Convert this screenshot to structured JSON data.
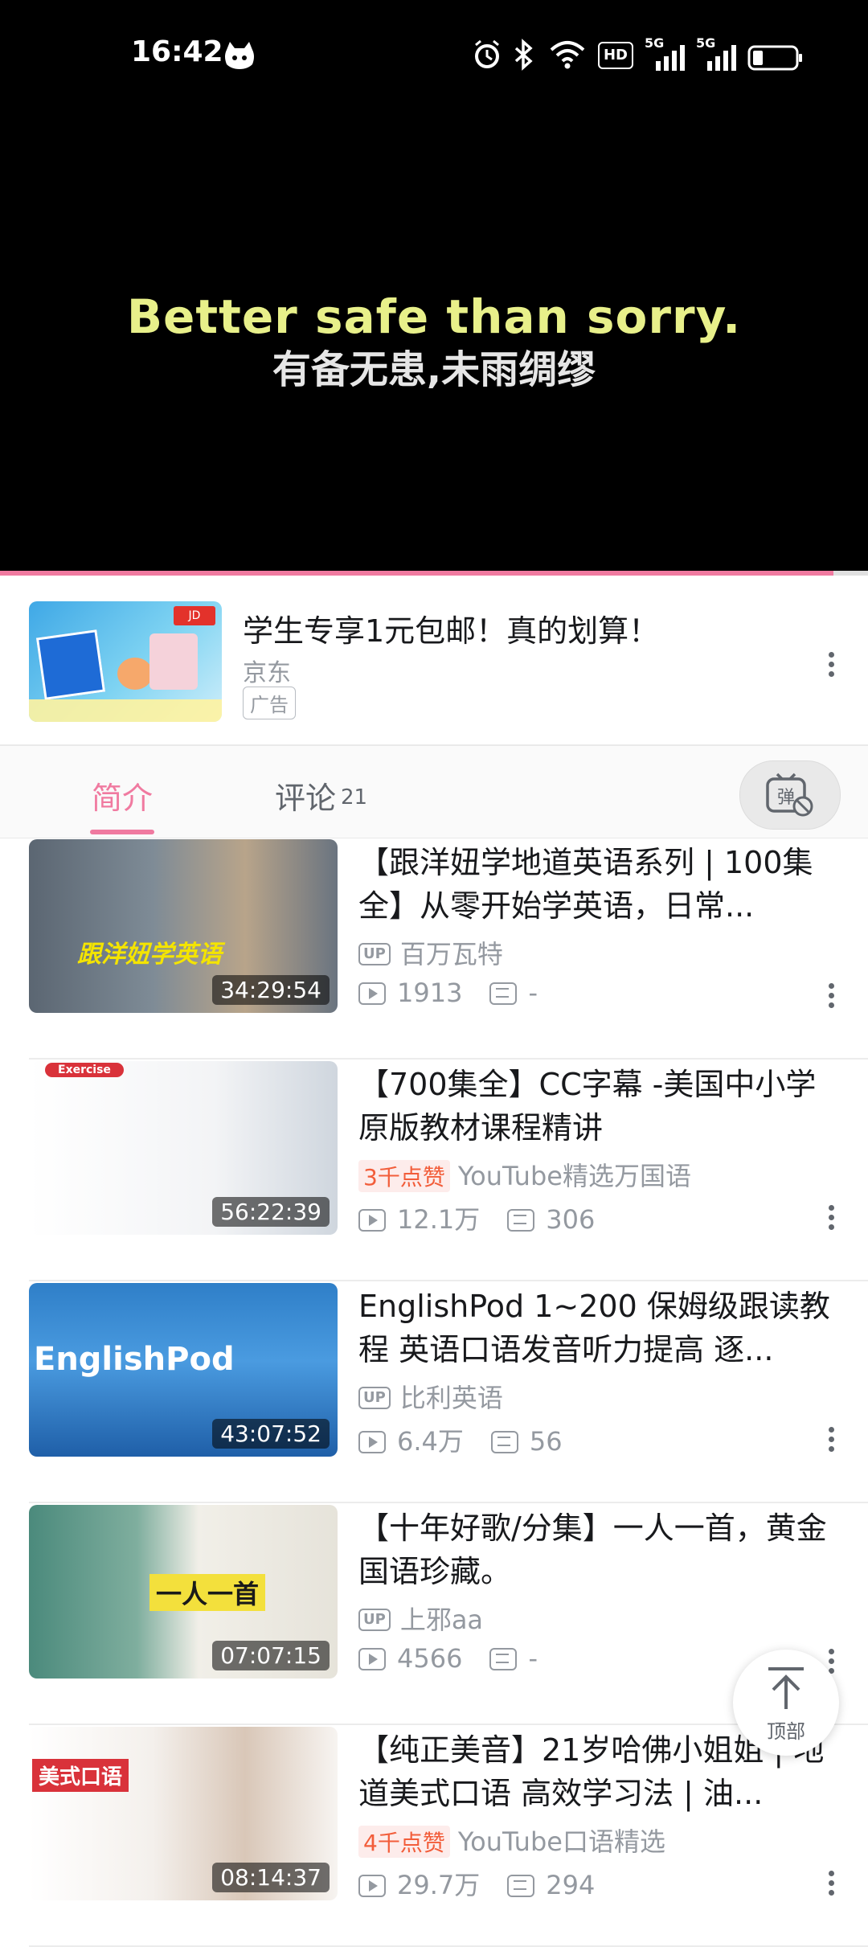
{
  "status_bar": {
    "time": "16:42",
    "icons": [
      "cat-app-icon",
      "alarm-icon",
      "bluetooth-icon",
      "wifi-icon",
      "hd-icon",
      "5g-signal-icon",
      "5g-signal-icon",
      "battery-icon"
    ],
    "hd_label": "HD",
    "net_label_1": "5G",
    "net_label_2": "5G"
  },
  "video": {
    "subtitle_en": "Better safe than sorry.",
    "subtitle_cn": "有备无患,未雨绸缪",
    "progress": 0.96
  },
  "ad": {
    "title": "学生专享1元包邮！真的划算！",
    "source": "京东",
    "badge": "广告"
  },
  "tabs": {
    "intro": "简介",
    "comments": "评论",
    "comments_count": "21",
    "danmaku_icon": "弹"
  },
  "videos": [
    {
      "title": "【跟洋妞学地道英语系列 | 100集全】从零开始学英语，日常...",
      "duration": "34:29:54",
      "author": "百万瓦特",
      "author_badge": "UP",
      "likes_badge": "",
      "views": "1913",
      "comments": "-",
      "thumb_text": "跟洋妞学英语"
    },
    {
      "title": "【700集全】CC字幕 -美国中小学原版教材课程精讲",
      "duration": "56:22:39",
      "author": "YouTube精选万国语",
      "author_badge": "",
      "likes_badge": "3千点赞",
      "views": "12.1万",
      "comments": "306",
      "thumb_text": "Exercise"
    },
    {
      "title": "EnglishPod 1~200 保姆级跟读教程 英语口语发音听力提高 逐...",
      "duration": "43:07:52",
      "author": "比利英语",
      "author_badge": "UP",
      "likes_badge": "",
      "views": "6.4万",
      "comments": "56",
      "thumb_text": "EnglishPod"
    },
    {
      "title": "【十年好歌/分集】一人一首，黄金国语珍藏。",
      "duration": "07:07:15",
      "author": "上邪aa",
      "author_badge": "UP",
      "likes_badge": "",
      "views": "4566",
      "comments": "-",
      "thumb_text": "一人一首"
    },
    {
      "title": "【纯正美音】21岁哈佛小姐姐 | 地道美式口语 高效学习法 | 油...",
      "duration": "08:14:37",
      "author": "YouTube口语精选",
      "author_badge": "",
      "likes_badge": "4千点赞",
      "views": "29.7万",
      "comments": "294",
      "thumb_text": "美式口语"
    }
  ],
  "top_button": {
    "label": "顶部"
  },
  "colors": {
    "accent": "#f07aa0",
    "muted": "#9499a0",
    "likes": "#f25d3a"
  }
}
